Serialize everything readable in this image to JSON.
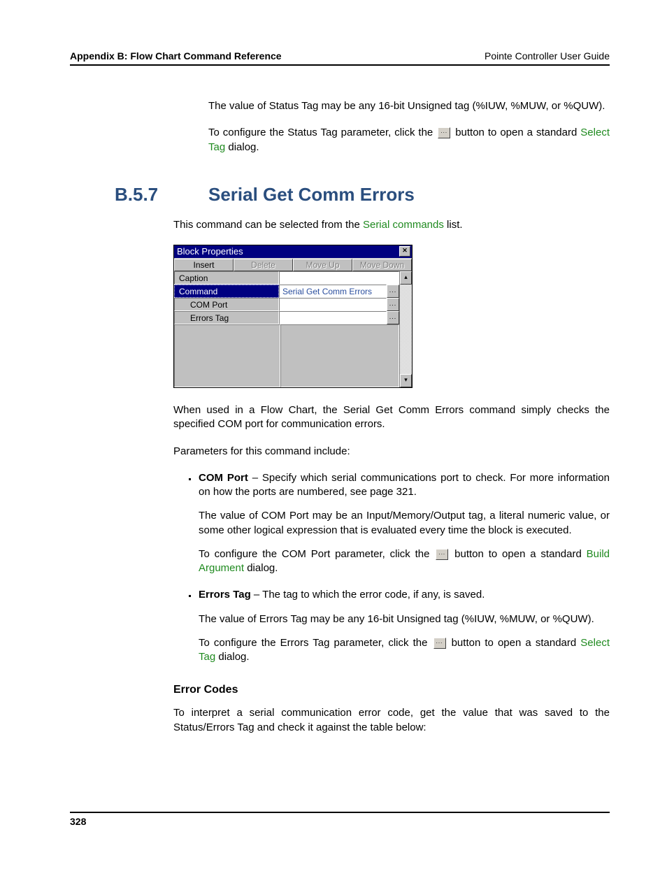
{
  "header": {
    "left": "Appendix B: Flow Chart Command Reference",
    "right": "Pointe Controller User Guide"
  },
  "intro": {
    "p1": "The value of Status Tag may be any 16-bit Unsigned tag (%IUW, %MUW, or %QUW).",
    "p2a": "To configure the Status Tag parameter, click the ",
    "p2b": " button to open a standard ",
    "link1": "Select Tag",
    "p2c": " dialog."
  },
  "heading": {
    "num": "B.5.7",
    "title": "Serial Get Comm Errors"
  },
  "after_heading": {
    "p1a": "This command can be selected from the ",
    "link": "Serial commands",
    "p1b": " list."
  },
  "dialog": {
    "title": "Block Properties",
    "tabs": {
      "insert": "Insert",
      "delete": "Delete",
      "moveup": "Move Up",
      "movedown": "Move Down"
    },
    "rows": {
      "caption": "Caption",
      "command": "Command",
      "command_val": "Serial Get Comm Errors",
      "comport": "COM Port",
      "errorstag": "Errors Tag"
    },
    "ellipsis": "...",
    "up": "▴",
    "down": "▾",
    "close": "✕"
  },
  "body": {
    "p1": "When used in a Flow Chart, the Serial Get Comm Errors command simply checks the specified COM port for communication errors.",
    "p2": "Parameters for this command include:",
    "li1": {
      "bold": "COM Port",
      "rest": " – Specify which serial communications port to check. For more information on how the ports are numbered, see page 321.",
      "sub1": "The value of COM Port may be an Input/Memory/Output tag, a literal numeric value, or some other logical expression that is evaluated every time the block is executed.",
      "sub2a": "To configure the COM Port parameter, click the ",
      "sub2b": " button to open a standard ",
      "sub2link": "Build Argument",
      "sub2c": " dialog."
    },
    "li2": {
      "bold": "Errors Tag",
      "rest": " – The tag to which the error code, if any, is saved.",
      "sub1": "The value of Errors Tag may be any 16-bit Unsigned tag (%IUW, %MUW, or %QUW).",
      "sub2a": "To configure the Errors Tag parameter, click the ",
      "sub2b": " button to open a standard ",
      "sub2link": "Select Tag",
      "sub2c": " dialog."
    }
  },
  "errorcodes": {
    "title": "Error Codes",
    "p": "To interpret a serial communication error code, get the value that was saved to the Status/Errors Tag and check it against the table below:"
  },
  "footer": {
    "page": "328"
  }
}
